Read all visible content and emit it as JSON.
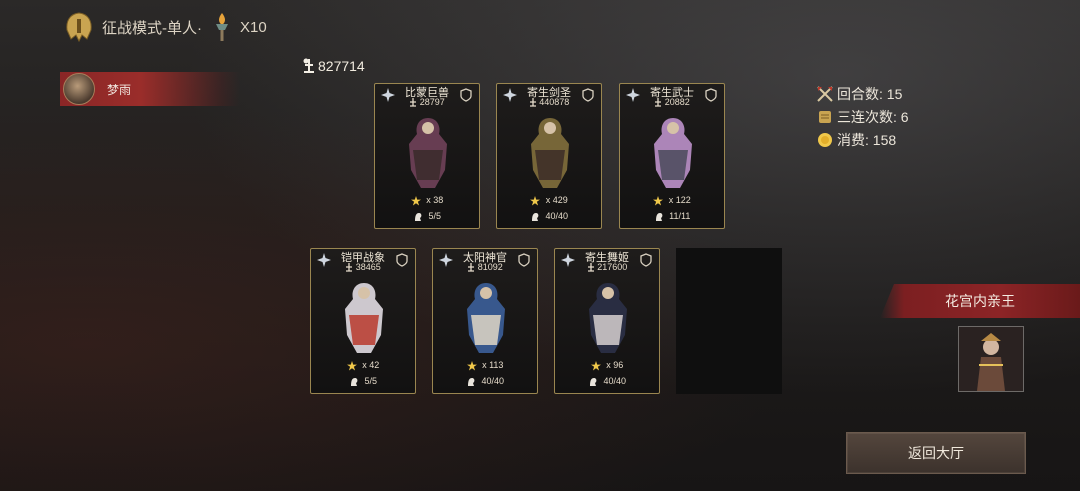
{
  "header": {
    "mode_label": "征战模式-单人·",
    "ticket_count": "X10",
    "icons": [
      "helmet-icon",
      "torch-icon"
    ]
  },
  "player": {
    "name": "梦雨"
  },
  "total_power": "827714",
  "cards": [
    {
      "name": "比蒙巨兽",
      "power": "28797",
      "stars": "x 38",
      "troops": "5/5",
      "faction_icon": "faction-icon",
      "role_icon": "shield-role-icon"
    },
    {
      "name": "寄生剑圣",
      "power": "440878",
      "stars": "x 429",
      "troops": "40/40",
      "faction_icon": "star-faction-icon",
      "role_icon": "shield-role-icon"
    },
    {
      "name": "寄生武士",
      "power": "20882",
      "stars": "x 122",
      "troops": "11/11",
      "faction_icon": "star-faction-icon",
      "role_icon": "shield-role-icon"
    },
    {
      "name": "铠甲战象",
      "power": "38465",
      "stars": "x 42",
      "troops": "5/5",
      "faction_icon": "faction-icon",
      "role_icon": "cavalry-role-icon"
    },
    {
      "name": "太阳神官",
      "power": "81092",
      "stars": "x 113",
      "troops": "40/40",
      "faction_icon": "star-faction-icon",
      "role_icon": "archer-role-icon"
    },
    {
      "name": "寄生舞姬",
      "power": "217600",
      "stars": "x 96",
      "troops": "40/40",
      "faction_icon": "star-faction-icon",
      "role_icon": "mage-role-icon"
    }
  ],
  "stats": {
    "rounds": "回合数: 15",
    "triple": "三连次数: 6",
    "cost": "消费: 158"
  },
  "enemy": {
    "name": "花宫内亲王"
  },
  "return_button": "返回大厅",
  "colors": {
    "accent_red": "#8c2426",
    "card_border": "#9a8650",
    "gold": "#f0c84a"
  }
}
